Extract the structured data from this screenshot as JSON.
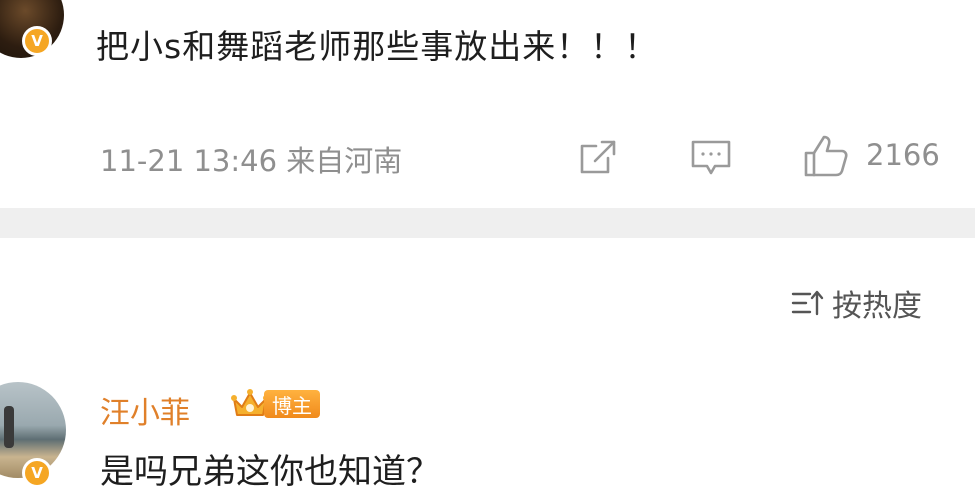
{
  "comment": {
    "text": "把小s和舞蹈老师那些事放出来！！！",
    "meta": "11-21 13:46  来自河南",
    "actions": {
      "share_icon": "share-icon",
      "comment_icon": "comment-icon",
      "like_icon": "thumbs-up-icon",
      "like_count": "2166"
    },
    "avatar_badge": "V"
  },
  "sort": {
    "icon": "sort-icon",
    "label": "按热度"
  },
  "reply": {
    "username": "汪小菲",
    "badge_label": "博主",
    "badge_icon": "crown-icon",
    "avatar_badge": "V",
    "text": "是吗兄弟这你也知道？"
  },
  "colors": {
    "username": "#e0802a",
    "verified_badge": "#f5a623",
    "muted_text": "#8f8f8f",
    "divider": "#efefef"
  }
}
